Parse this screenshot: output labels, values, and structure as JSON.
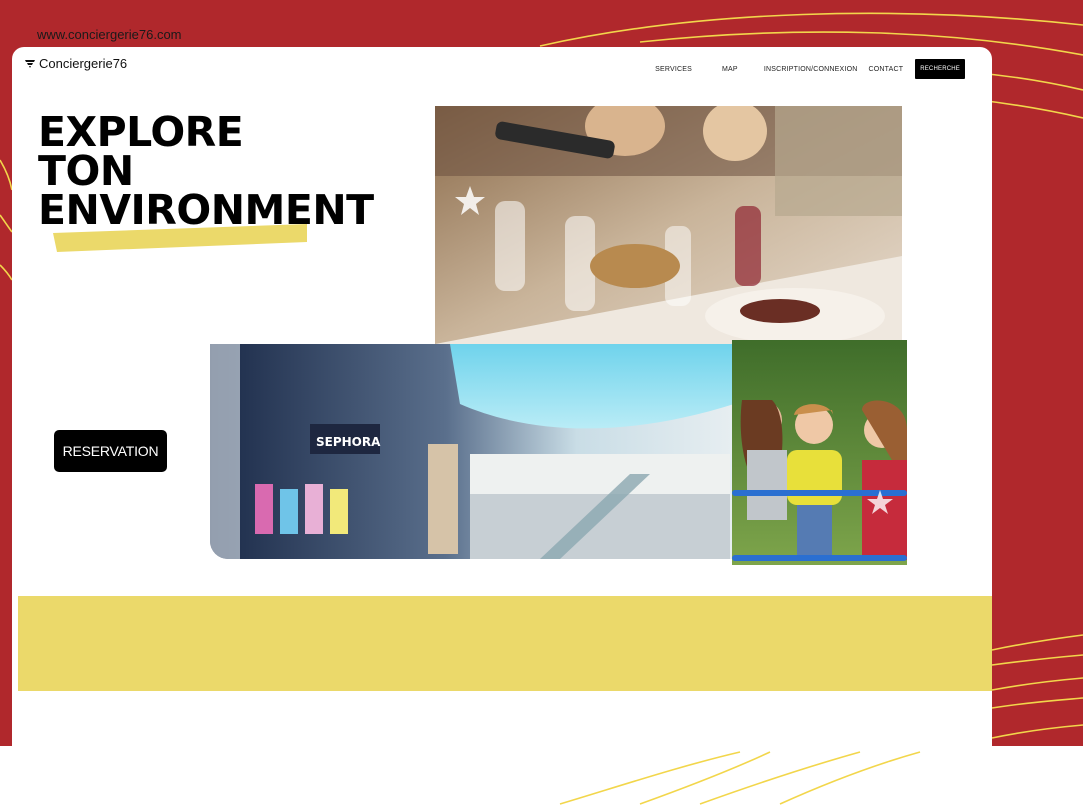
{
  "site_url": "www.conciergerie76.com",
  "brand": {
    "name": "Conciergerie76",
    "icon": "wifi-icon"
  },
  "nav": {
    "services": "SERVICES",
    "map": "MAP",
    "inscription": "INSCRIPTION/CONNEXION",
    "contact": "CONTACT",
    "search": "RECHERCHE"
  },
  "hero": {
    "line1": "EXPLORE",
    "line2": "TON",
    "line3": "ENVIRONMENT",
    "cta": "RESERVATION"
  },
  "images": {
    "dinner": "restaurant-dinner-photo",
    "mall": "shopping-mall-photo",
    "kids": "children-playground-photo"
  },
  "colors": {
    "background_red": "#b0282c",
    "accent_yellow": "#ebd96a",
    "button_black": "#000000",
    "curve_yellow": "#f2d64b"
  }
}
